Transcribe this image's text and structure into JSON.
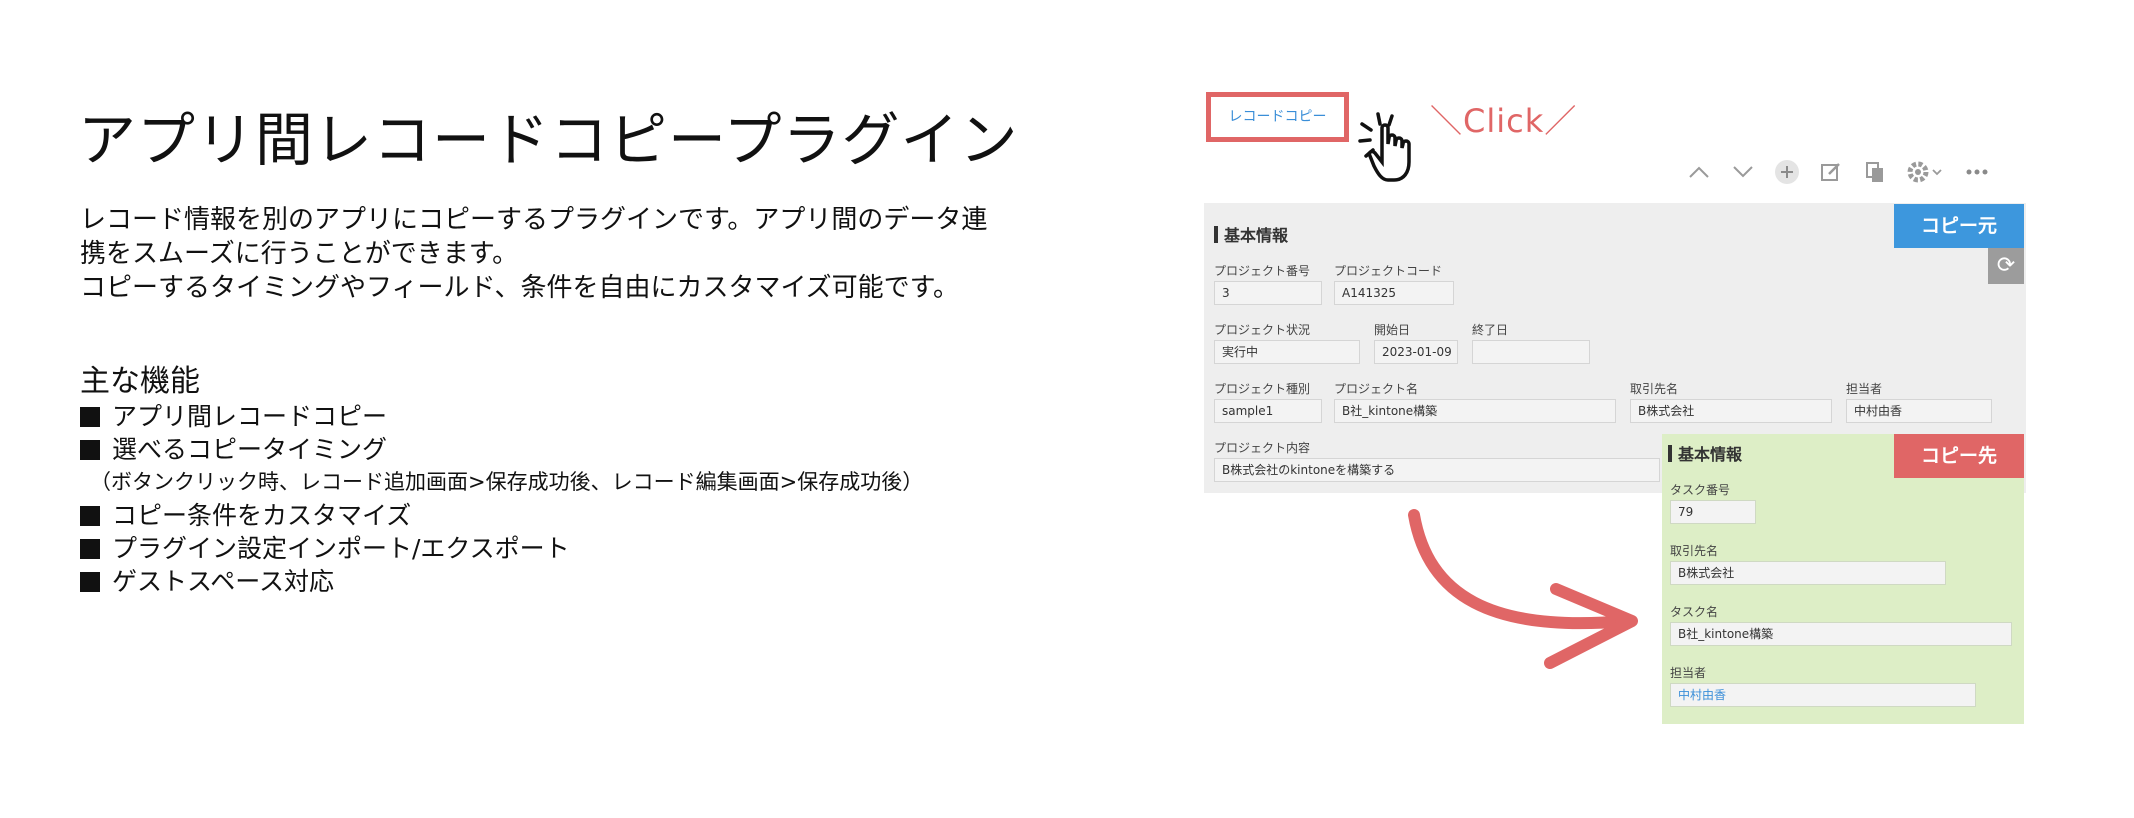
{
  "title": "アプリ間レコードコピープラグイン",
  "description": [
    "レコード情報を別のアプリにコピーするプラグインです。アプリ間のデータ連",
    "携をスムーズに行うことができます。",
    "コピーするタイミングやフィールド、条件を自由にカスタマイズ可能です。"
  ],
  "features": {
    "heading": "主な機能",
    "items": [
      "アプリ間レコードコピー",
      "選べるコピータイミング"
    ],
    "note": "（ボタンクリック時、レコード追加画面>保存成功後、レコード編集画面>保存成功後）",
    "items_after": [
      "コピー条件をカスタマイズ",
      "プラグイン設定インポート/エクスポート",
      "ゲストスペース対応"
    ]
  },
  "screenshot": {
    "copy_button": "レコードコピー",
    "click_text": "＼Click／",
    "source": {
      "badge": "コピー元",
      "section": "基本情報",
      "fields": {
        "project_no": {
          "label": "プロジェクト番号",
          "value": "3"
        },
        "project_code": {
          "label": "プロジェクトコード",
          "value": "A141325"
        },
        "status": {
          "label": "プロジェクト状況",
          "value": "実行中"
        },
        "start": {
          "label": "開始日",
          "value": "2023-01-09"
        },
        "end": {
          "label": "終了日",
          "value": ""
        },
        "type": {
          "label": "プロジェクト種別",
          "value": "sample1"
        },
        "name": {
          "label": "プロジェクト名",
          "value": "B社_kintone構築"
        },
        "client": {
          "label": "取引先名",
          "value": "B株式会社"
        },
        "owner": {
          "label": "担当者",
          "value": "中村由香"
        },
        "content": {
          "label": "プロジェクト内容",
          "value": "B株式会社のkintoneを構築する"
        }
      }
    },
    "destination": {
      "badge": "コピー先",
      "section": "基本情報",
      "fields": {
        "task_no": {
          "label": "タスク番号",
          "value": "79"
        },
        "client": {
          "label": "取引先名",
          "value": "B株式会社"
        },
        "task_name": {
          "label": "タスク名",
          "value": "B社_kintone構築"
        },
        "owner": {
          "label": "担当者",
          "value": "中村由香"
        }
      }
    },
    "colors": {
      "source_badge": "#3d97dd",
      "dest_badge": "#e06666",
      "dest_panel": "#ddeec6",
      "accent_red": "#e06666"
    }
  }
}
